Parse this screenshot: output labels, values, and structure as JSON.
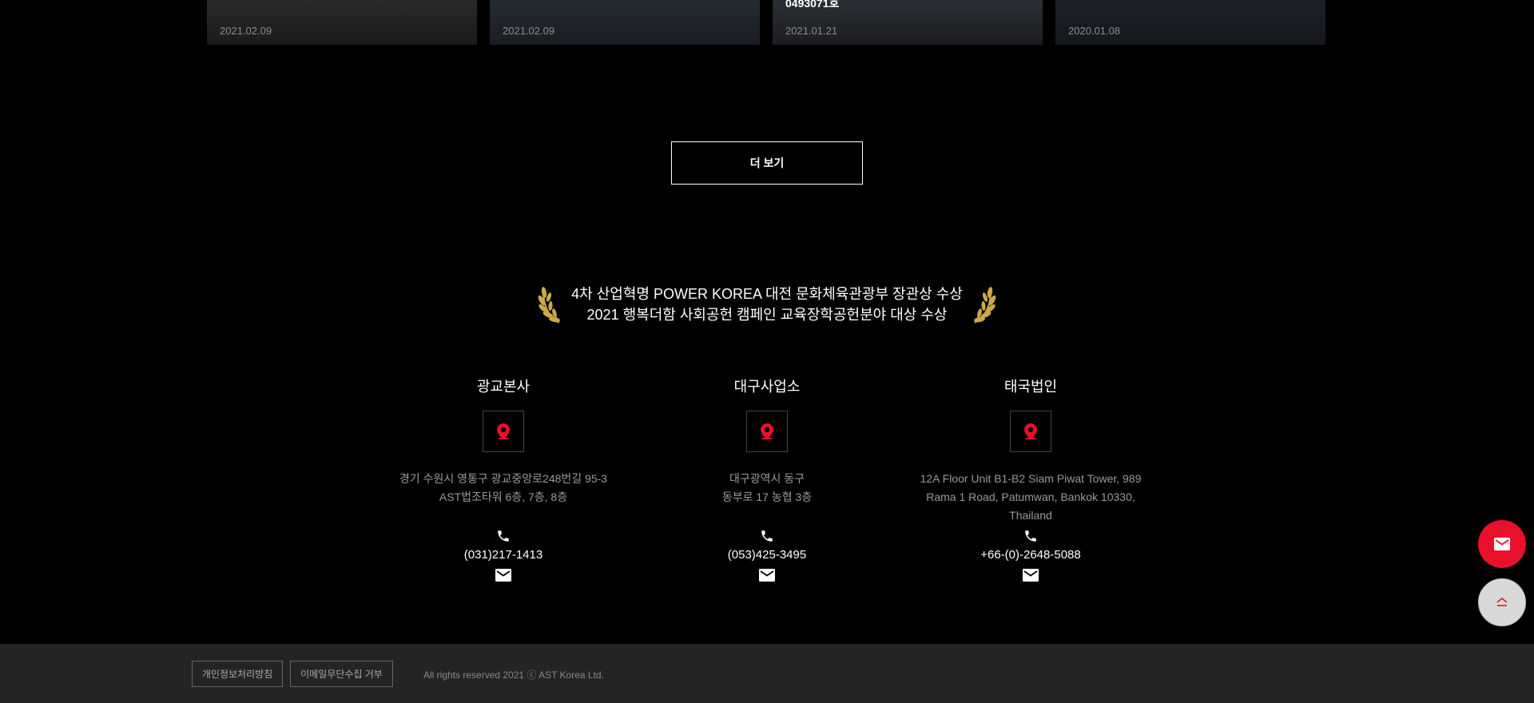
{
  "news_cards": [
    {
      "date": "2021.02.09",
      "snippet": ""
    },
    {
      "date": "2021.02.09",
      "snippet": ""
    },
    {
      "date": "2021.01.21",
      "snippet": "0493071호"
    },
    {
      "date": "2020.01.08",
      "snippet": ""
    }
  ],
  "more_button_label": "더 보기",
  "award": {
    "line1": "4차 산업혁명 POWER KOREA 대전 문화체육관광부 장관상 수상",
    "line2": "2021 행복더함 사회공헌 캠페인 교육장학공헌분야 대상 수상"
  },
  "offices": [
    {
      "name": "광교본사",
      "address_line1": "경기 수원시 영통구 광교중앙로248번길 95-3",
      "address_line2": "AST법조타워 6층, 7층, 8층",
      "address_line3": "",
      "phone": "(031)217-1413"
    },
    {
      "name": "대구사업소",
      "address_line1": "대구광역시 동구",
      "address_line2": "동부로 17 농협 3층",
      "address_line3": "",
      "phone": "(053)425-3495"
    },
    {
      "name": "태국법인",
      "address_line1": "12A Floor Unit B1-B2 Siam Piwat Tower, 989",
      "address_line2": "Rama 1 Road, Patumwan, Bankok 10330,",
      "address_line3": "Thailand",
      "phone": "+66-(0)-2648-5088"
    }
  ],
  "footer": {
    "privacy_label": "개인정보처리방침",
    "email_refuse_label": "이메일무단수집 거부",
    "copyright": "All rights reserved 2021 ⓒ AST Korea Ltd."
  },
  "colors": {
    "accent": "#e8102b",
    "background": "#000000",
    "footer_bg": "#242424"
  },
  "icons": {
    "pin": "map-pin-icon",
    "phone": "phone-icon",
    "mail": "mail-icon",
    "top": "scroll-top-icon",
    "laurel": "laurel-icon"
  }
}
